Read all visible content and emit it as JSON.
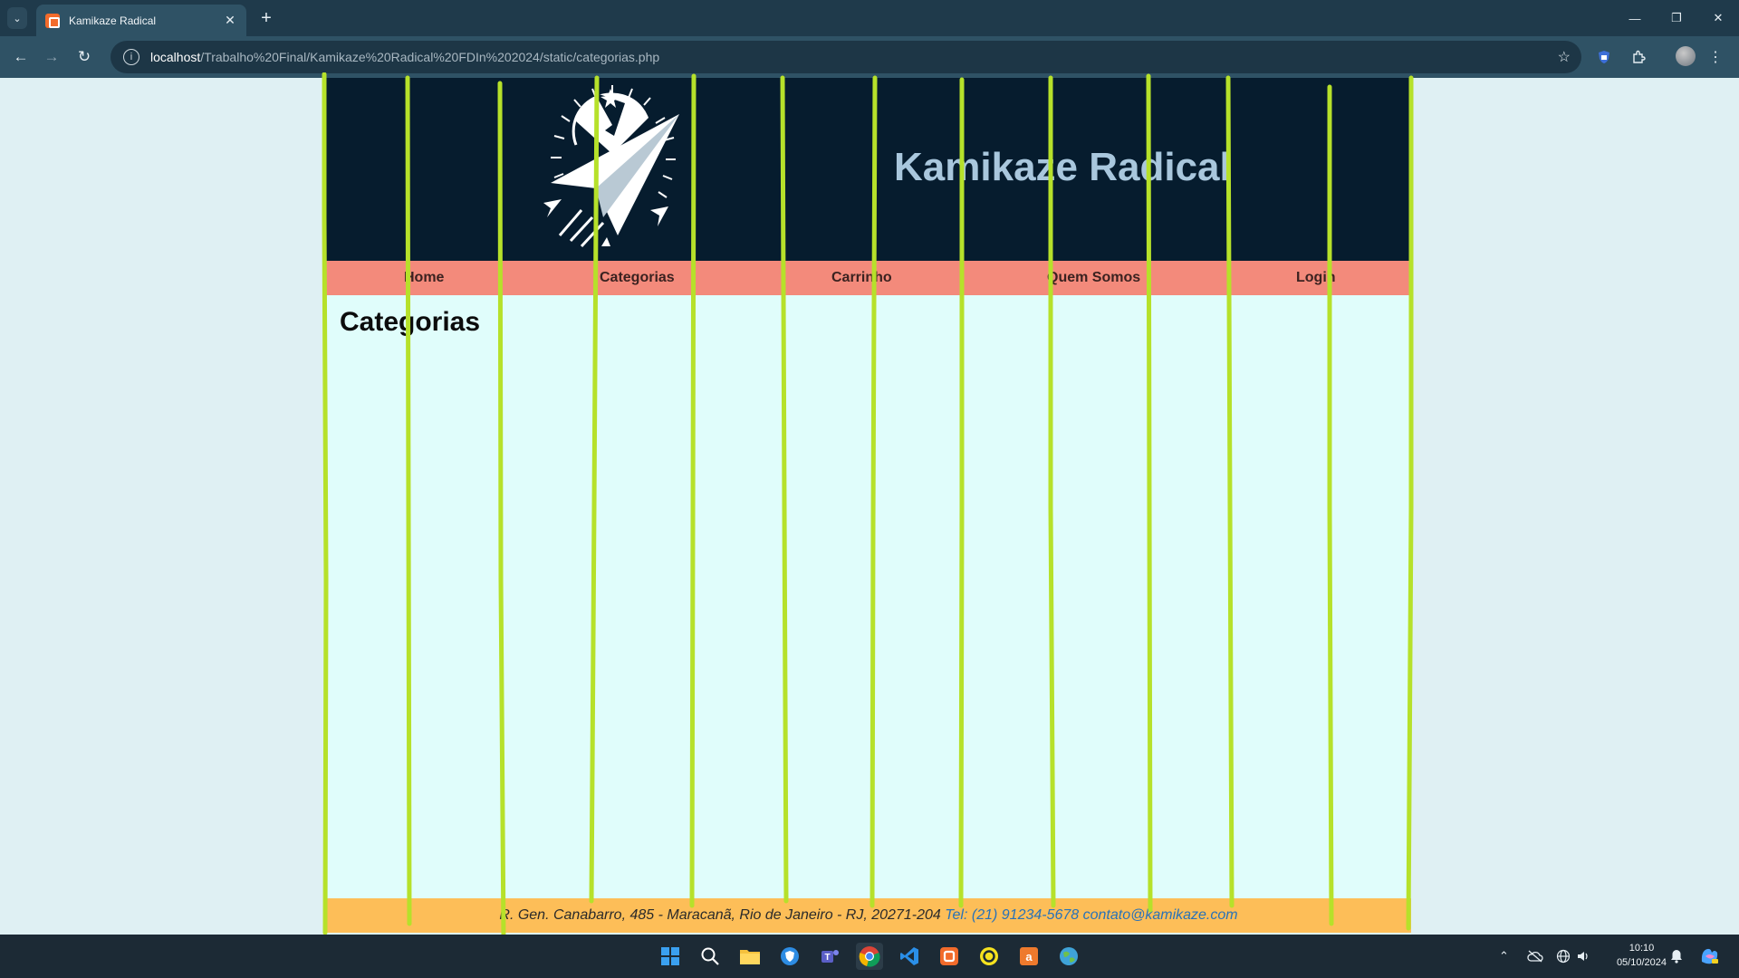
{
  "browser": {
    "tab_title": "Kamikaze Radical",
    "url_host": "localhost",
    "url_path": "/Trabalho%20Final/Kamikaze%20Radical%20FDIn%202024/static/categorias.php"
  },
  "site": {
    "title": "Kamikaze Radical",
    "nav": [
      "Home",
      "Categorias",
      "Carrinho",
      "Quem Somos",
      "Login"
    ],
    "page_heading": "Categorias",
    "footer_address": "R. Gen. Canabarro, 485 - Maracanã, Rio de Janeiro - RJ, 20271-204",
    "footer_contact": "Tel: (21) 91234-5678 contato@kamikaze.com"
  },
  "taskbar": {
    "time": "10:10",
    "date": "05/10/2024",
    "apps": [
      "windows-start-icon",
      "search-icon",
      "file-explorer-icon",
      "browser-shield-icon",
      "teams-icon",
      "chrome-icon",
      "vscode-icon",
      "xampp-icon",
      "sync-app-icon",
      "sublime-icon",
      "network-globe-icon"
    ]
  },
  "colors": {
    "header_bg": "#061c2e",
    "nav_bg": "#f38a7b",
    "content_bg": "#e0fdfb",
    "footer_bg": "#fdbe58",
    "title_color": "#a9c7dd",
    "overlay_line": "#b6e12a"
  }
}
